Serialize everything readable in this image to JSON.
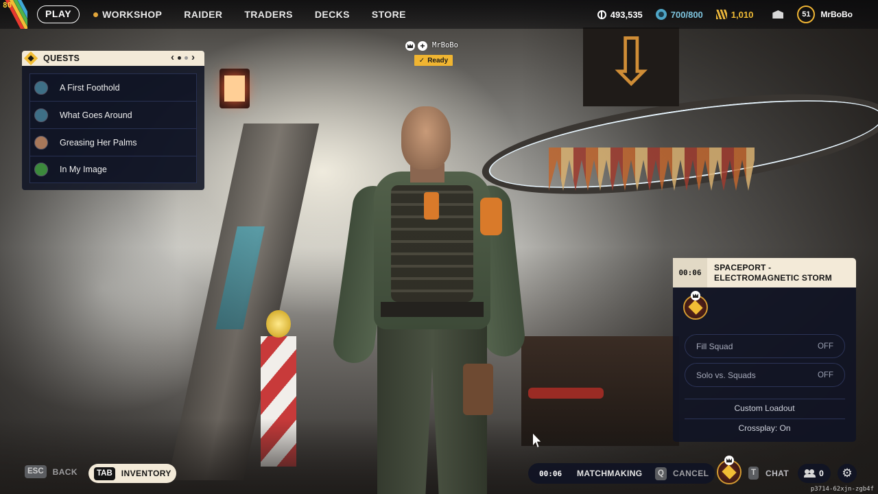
{
  "logo": {
    "level_number": "80"
  },
  "nav": {
    "play": "PLAY",
    "workshop": "WORKSHOP",
    "raider": "RAIDER",
    "traders": "TRADERS",
    "decks": "DECKS",
    "store": "STORE"
  },
  "currencies": {
    "coins": "493,535",
    "gear_capacity": "700/800",
    "credits": "1,010"
  },
  "player": {
    "level": "51",
    "name": "MrBoBo"
  },
  "quests": {
    "title": "QUESTS",
    "pager_prev": "‹",
    "pager_next": "›",
    "page_count": 2,
    "current_page": 1,
    "items": [
      {
        "label": "A First Foothold",
        "avatar": "#3e6f86"
      },
      {
        "label": "What Goes Around",
        "avatar": "#3e6f86"
      },
      {
        "label": "Greasing Her Palms",
        "avatar": "#a8785a"
      },
      {
        "label": "In My Image",
        "avatar": "#3c8a3c"
      }
    ]
  },
  "squad": {
    "name": "MrBoBo",
    "status": "Ready"
  },
  "matchmaking_panel": {
    "timer": "00:06",
    "map_name": "SPACEPORT - ELECTROMAGNETIC STORM",
    "fill_squad_label": "Fill Squad",
    "fill_squad_value": "OFF",
    "solo_label": "Solo vs. Squads",
    "solo_value": "OFF",
    "custom_loadout": "Custom Loadout",
    "crossplay": "Crossplay: On"
  },
  "bottom": {
    "back_key": "ESC",
    "back_label": "BACK",
    "inventory_key": "TAB",
    "inventory_label": "INVENTORY",
    "mm_timer": "00:06",
    "mm_label": "MATCHMAKING",
    "cancel_key": "Q",
    "cancel_label": "CANCEL",
    "chat_key": "T",
    "chat_label": "CHAT",
    "friends_count": "0",
    "build_id": "p3714-62xjn-zgb4f"
  },
  "colors": {
    "accent_yellow": "#f2bd35",
    "panel_bg": "#10142a",
    "header_cream": "#f3ead8"
  }
}
